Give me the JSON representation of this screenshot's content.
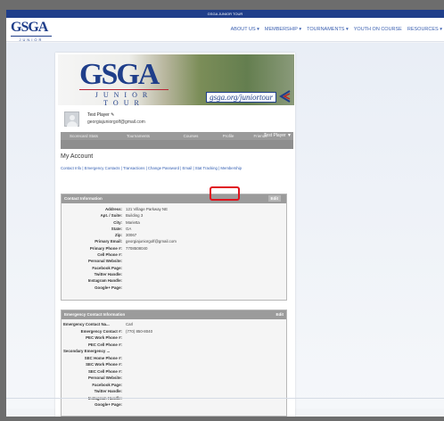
{
  "topbar": {
    "text": "GSGA JUNIOR TOUR"
  },
  "navbar": {
    "logo_main": "GSGA",
    "logo_sub": "JUNIOR TOUR",
    "items": [
      "ABOUT US ▾",
      "MEMBERSHIP ▾",
      "TOURNAMENTS ▾",
      "YOUTH ON COURSE",
      "RESOURCES ▾"
    ]
  },
  "banner": {
    "logo_main": "GSGA",
    "logo_sub": "JUNIOR TOUR",
    "url": "gsga.org/juniortour"
  },
  "profile": {
    "name": "Test Player ✎",
    "email": "georgiajuniorgolf@gmail.com"
  },
  "tabs": [
    "Scorecard Stats",
    "Tournaments",
    "Courses",
    "Profile",
    "Friends"
  ],
  "user_menu": "Test Player ▼",
  "heading": "My Account",
  "links": "Contact Info | Emergency Contacts | Transactions | Change Password | Email | Stat Tracking | Membership",
  "contact": {
    "title": "Contact Information",
    "edit": "Edit",
    "rows": [
      {
        "label": "Address:",
        "value": "121 Village Parkway NE"
      },
      {
        "label": "Apt. / Suite:",
        "value": "Building 3"
      },
      {
        "label": "City:",
        "value": "Marietta"
      },
      {
        "label": "State:",
        "value": "GA"
      },
      {
        "label": "Zip:",
        "value": "30067"
      },
      {
        "label": "Primary Email:",
        "value": "georgiajuniorgolf@gmail.com"
      },
      {
        "label": "Primary Phone #:",
        "value": "7708508040"
      },
      {
        "label": "Cell Phone #:",
        "value": ""
      },
      {
        "label": "Personal Website:",
        "value": ""
      },
      {
        "label": "Facebook Page:",
        "value": ""
      },
      {
        "label": "Twitter Handle:",
        "value": ""
      },
      {
        "label": "Instagram Handle:",
        "value": ""
      },
      {
        "label": "Google+ Page:",
        "value": ""
      }
    ]
  },
  "emergency": {
    "title": "Emergency Contact Information",
    "edit": "Edit",
    "rows": [
      {
        "label": "Emergency Contact Na...",
        "value": "Carl"
      },
      {
        "label": "Emergency Contact #:",
        "value": "(770) 850-8040"
      },
      {
        "label": "PEC Work Phone #:",
        "value": ""
      },
      {
        "label": "PEC Cell Phone #:",
        "value": ""
      },
      {
        "label": "Secondary Emergency ...",
        "value": ""
      },
      {
        "label": "SEC Home Phone #:",
        "value": ""
      },
      {
        "label": "SEC Work Phone #:",
        "value": ""
      },
      {
        "label": "SEC Cell Phone #:",
        "value": ""
      },
      {
        "label": "Personal Website:",
        "value": ""
      },
      {
        "label": "Facebook Page:",
        "value": ""
      },
      {
        "label": "Twitter Handle:",
        "value": ""
      },
      {
        "label": "Instagram Handle:",
        "value": ""
      },
      {
        "label": "Google+ Page:",
        "value": ""
      }
    ]
  },
  "colors": {
    "brand": "#1f3e8a",
    "highlight": "#e0141e",
    "link": "#2f5bb0"
  }
}
